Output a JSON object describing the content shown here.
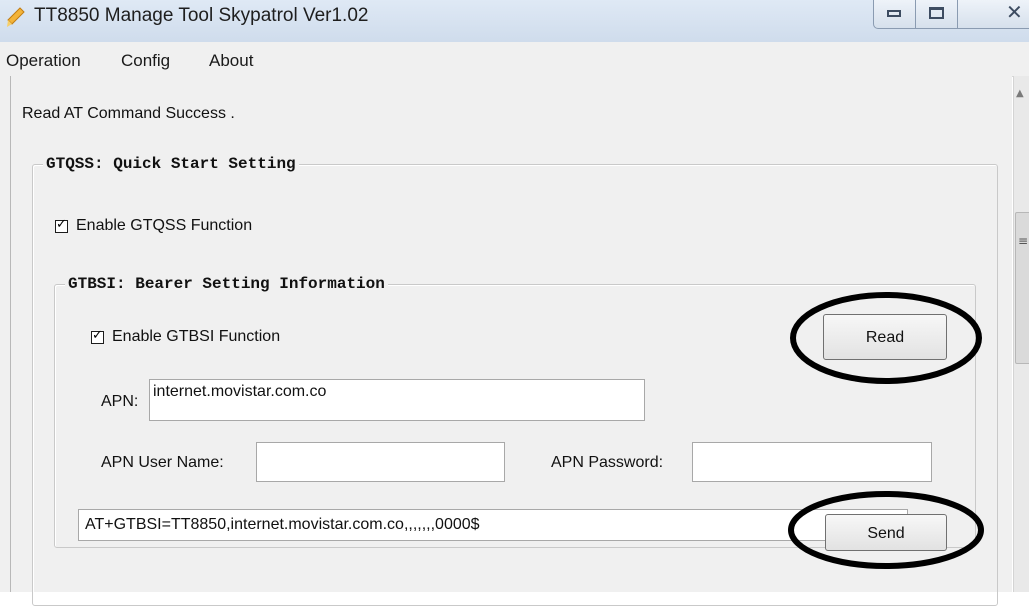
{
  "window": {
    "title": "TT8850 Manage Tool Skypatrol Ver1.02",
    "icon": "app-icon"
  },
  "menu": {
    "items": [
      "Operation",
      "Config",
      "About"
    ]
  },
  "status": {
    "message": "Read AT Command Success ."
  },
  "gtqss": {
    "legend": "GTQSS: Quick Start Setting",
    "enable_label": "Enable GTQSS Function",
    "enabled": true
  },
  "gtbsi": {
    "legend": "GTBSI: Bearer Setting Information",
    "enable_label": "Enable GTBSI Function",
    "enabled": true,
    "read_label": "Read",
    "apn_label": "APN:",
    "apn_value": "internet.movistar.com.co",
    "user_label": "APN User Name:",
    "user_value": "",
    "password_label": "APN Password:",
    "password_value": "",
    "command": "AT+GTBSI=TT8850,internet.movistar.com.co,,,,,,,0000$",
    "send_label": "Send"
  },
  "annotations": {
    "ellipse_color": "#000000"
  }
}
